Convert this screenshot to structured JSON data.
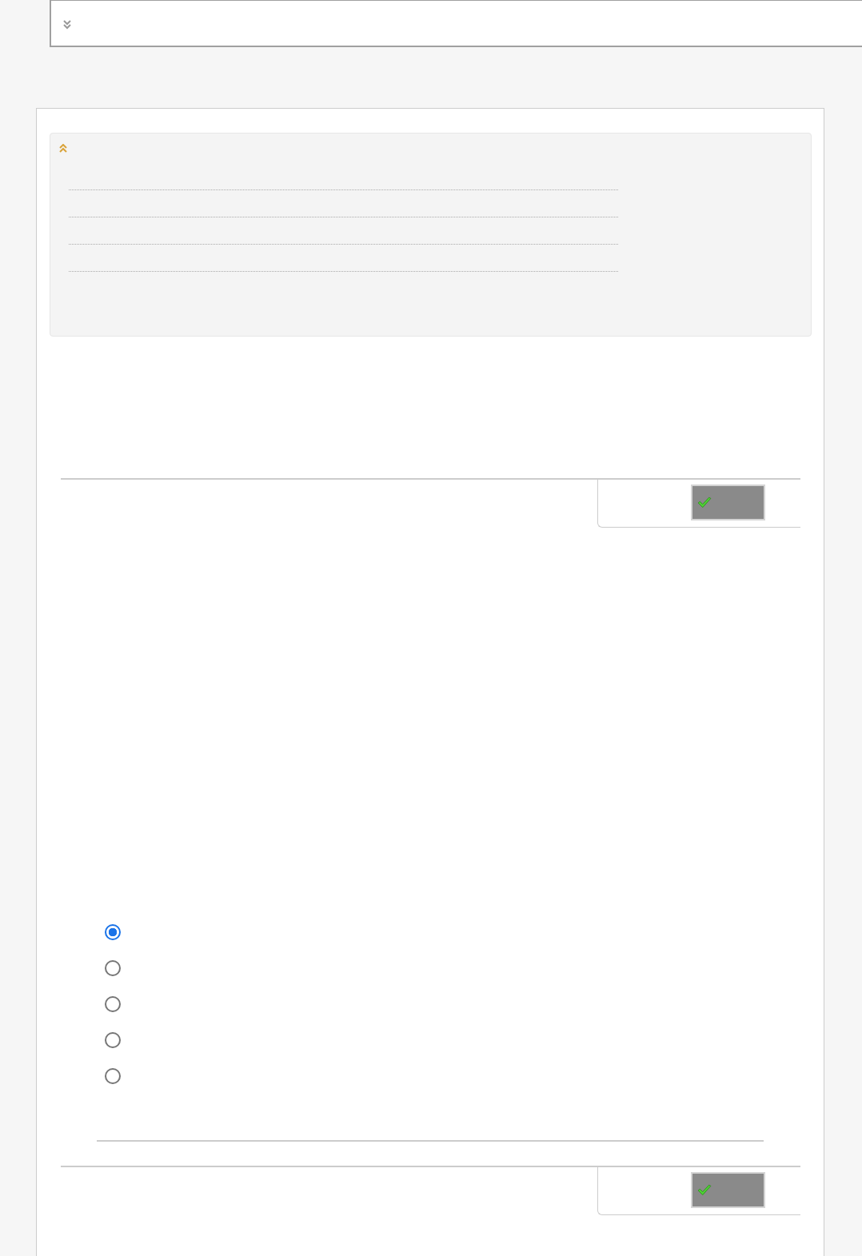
{
  "top_bar": {
    "expanded": false
  },
  "info_panel": {
    "expanded": true
  },
  "toolbars": [
    {
      "kind": "submit"
    },
    {
      "kind": "submit"
    }
  ],
  "options": [
    {
      "selected": true
    },
    {
      "selected": false
    },
    {
      "selected": false
    },
    {
      "selected": false
    },
    {
      "selected": false
    }
  ]
}
